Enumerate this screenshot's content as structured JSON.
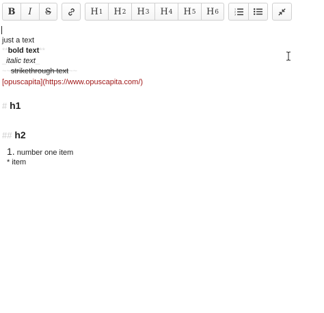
{
  "toolbar": {
    "format": [
      {
        "name": "bold-button",
        "label": "B",
        "style": "bold"
      },
      {
        "name": "italic-button",
        "label": "I",
        "style": "italic"
      },
      {
        "name": "strikethrough-button",
        "label": "S",
        "style": "strike"
      }
    ],
    "link": {
      "icon": "link-icon"
    },
    "headers": [
      {
        "name": "h1-button",
        "letter": "H",
        "num": "1"
      },
      {
        "name": "h2-button",
        "letter": "H",
        "num": "2"
      },
      {
        "name": "h3-button",
        "letter": "H",
        "num": "3"
      },
      {
        "name": "h4-button",
        "letter": "H",
        "num": "4"
      },
      {
        "name": "h5-button",
        "letter": "H",
        "num": "5"
      },
      {
        "name": "h6-button",
        "letter": "H",
        "num": "6"
      }
    ],
    "lists": [
      {
        "name": "ordered-list-button",
        "icon": "ordered-list-icon"
      },
      {
        "name": "unordered-list-button",
        "icon": "unordered-list-icon"
      }
    ],
    "fullscreen": {
      "icon": "collapse-icon"
    }
  },
  "editor": {
    "plain_text": "just a text",
    "bold_mark": "**",
    "bold_text": "bold text",
    "italic_mark": "_",
    "italic_text": "italic text",
    "strike_mark": "~~",
    "strike_text": "strikethrough text",
    "link_text": "[opuscapita](https://www.opuscapita.com/)",
    "h1_hash": "#",
    "h1_text": "h1",
    "h2_hash": "##",
    "h2_text": "h2",
    "ol_number": "1.",
    "ol_text": "number one item",
    "ul_bullet": "*",
    "ul_text": "item"
  },
  "colors": {
    "link": "#a01818",
    "markdown_marks": "#d9d9d9",
    "toolbar_border": "#cfcfcf"
  }
}
